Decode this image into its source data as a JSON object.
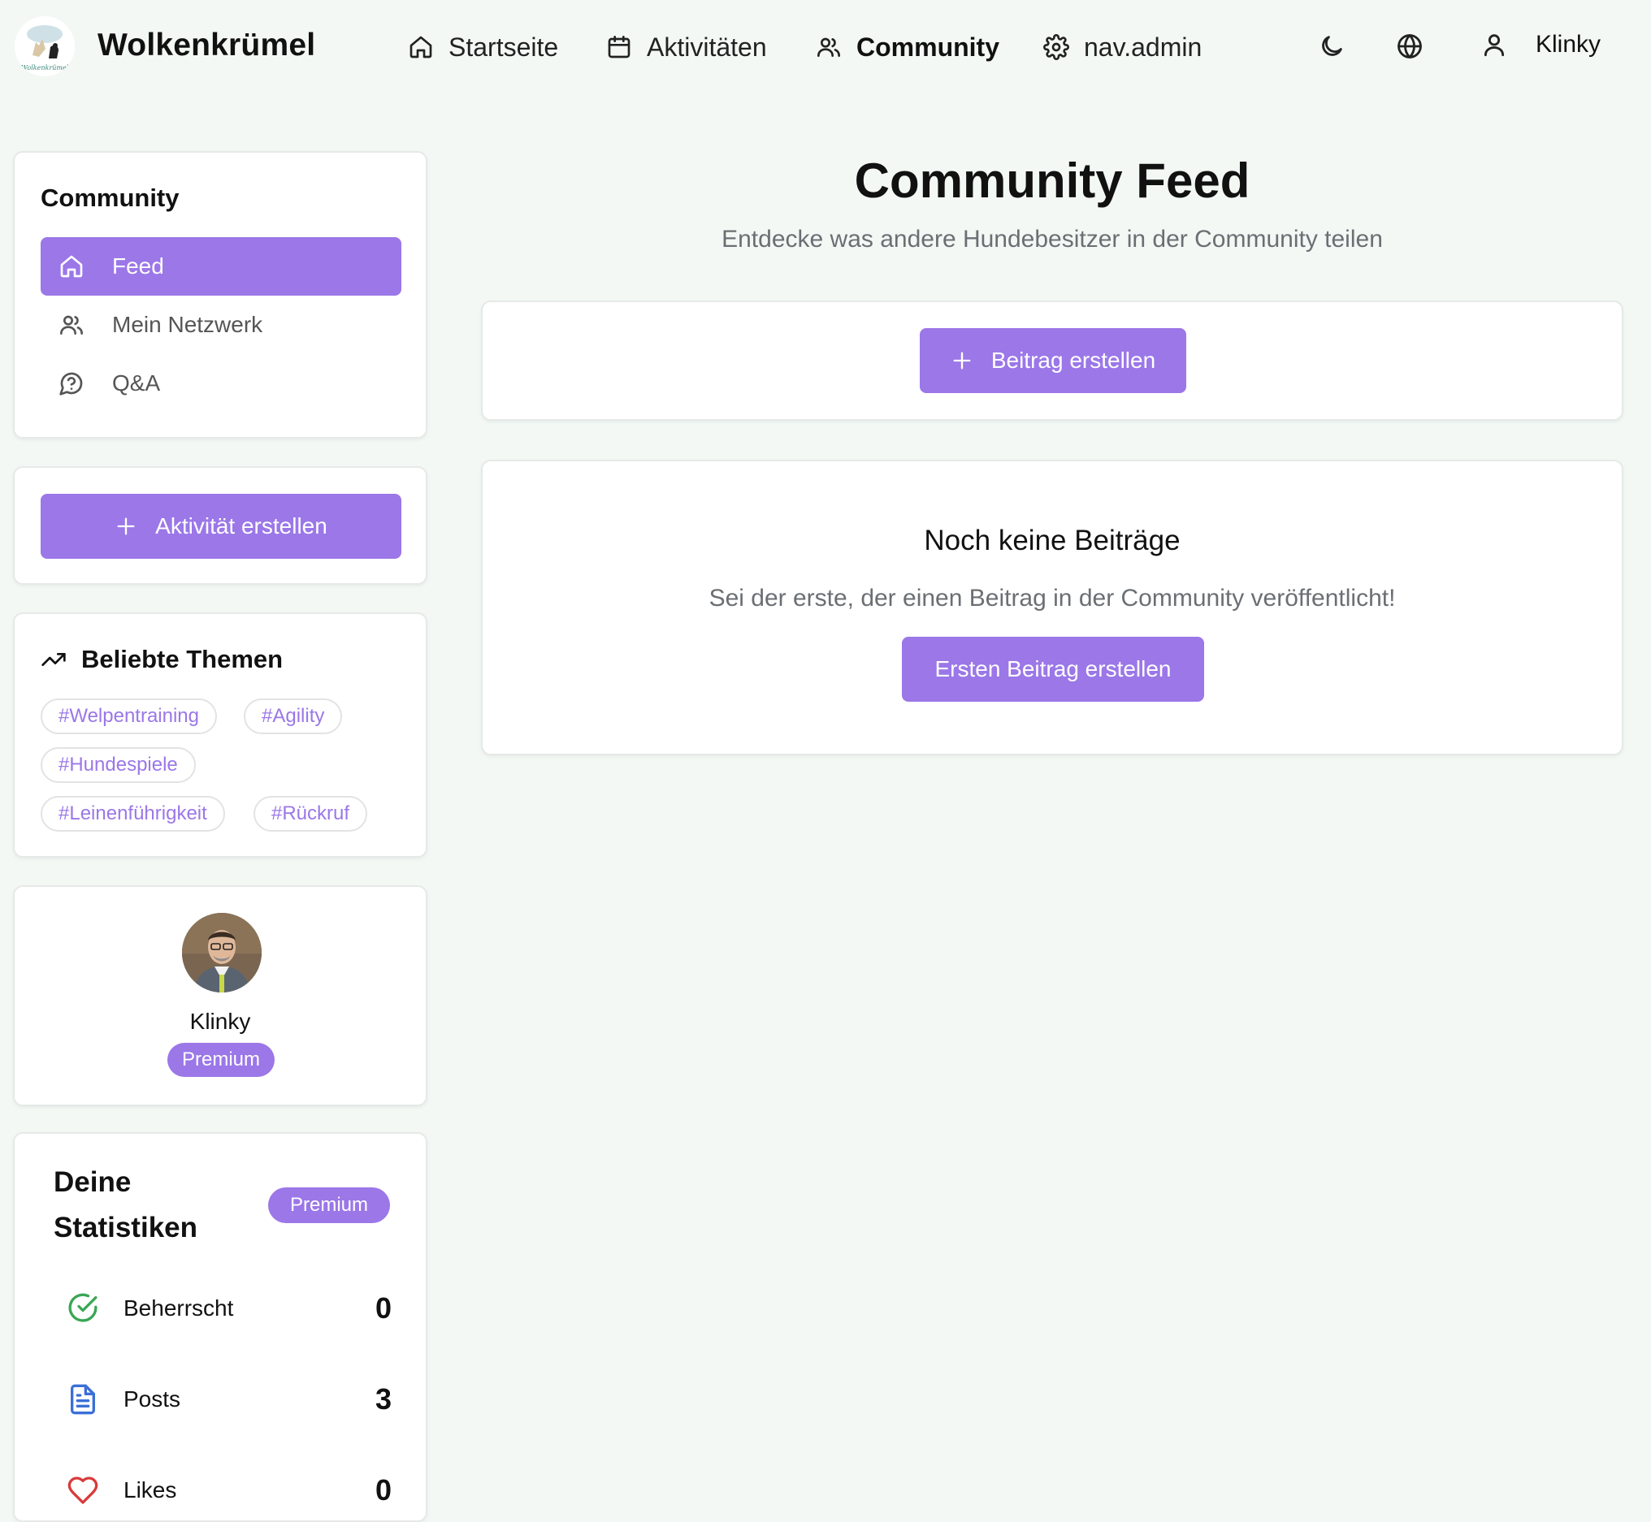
{
  "app": {
    "brand": "Wolkenkrümel",
    "logo_text": "Wolkenkrümel"
  },
  "nav": {
    "items": [
      {
        "label": "Startseite",
        "icon": "home-icon"
      },
      {
        "label": "Aktivitäten",
        "icon": "calendar-icon"
      },
      {
        "label": "Community",
        "icon": "users-icon",
        "active": true
      },
      {
        "label": "nav.admin",
        "icon": "gear-icon"
      }
    ],
    "user_name": "Klinky"
  },
  "sidebar": {
    "community": {
      "title": "Community",
      "items": [
        {
          "label": "Feed",
          "icon": "home-icon",
          "active": true
        },
        {
          "label": "Mein Netzwerk",
          "icon": "users-icon"
        },
        {
          "label": "Q&A",
          "icon": "message-question-icon"
        }
      ]
    },
    "create_activity_label": "Aktivität erstellen",
    "topics": {
      "title": "Beliebte Themen",
      "tags": [
        "#Welpentraining",
        "#Agility",
        "#Hundespiele",
        "#Leinenführigkeit",
        "#Rückruf"
      ]
    },
    "profile": {
      "name": "Klinky",
      "badge": "Premium"
    },
    "stats": {
      "title_line1": "Deine",
      "title_line2": "Statistiken",
      "badge": "Premium",
      "rows": [
        {
          "label": "Beherrscht",
          "value": "0",
          "icon": "check-circle-icon",
          "color": "#3aa655"
        },
        {
          "label": "Posts",
          "value": "3",
          "icon": "document-icon",
          "color": "#3b6fd8"
        },
        {
          "label": "Likes",
          "value": "0",
          "icon": "heart-icon",
          "color": "#d93a3a"
        }
      ]
    }
  },
  "main": {
    "title": "Community Feed",
    "subtitle": "Entdecke was andere Hundebesitzer in der Community teilen",
    "create_post_label": "Beitrag erstellen",
    "empty": {
      "title": "Noch keine Beiträge",
      "text": "Sei der erste, der einen Beitrag in der Community veröffentlicht!",
      "button": "Ersten Beitrag erstellen"
    }
  },
  "colors": {
    "accent": "#9b77e8",
    "background": "#f3f8f5",
    "muted_text": "#6b6f73"
  }
}
